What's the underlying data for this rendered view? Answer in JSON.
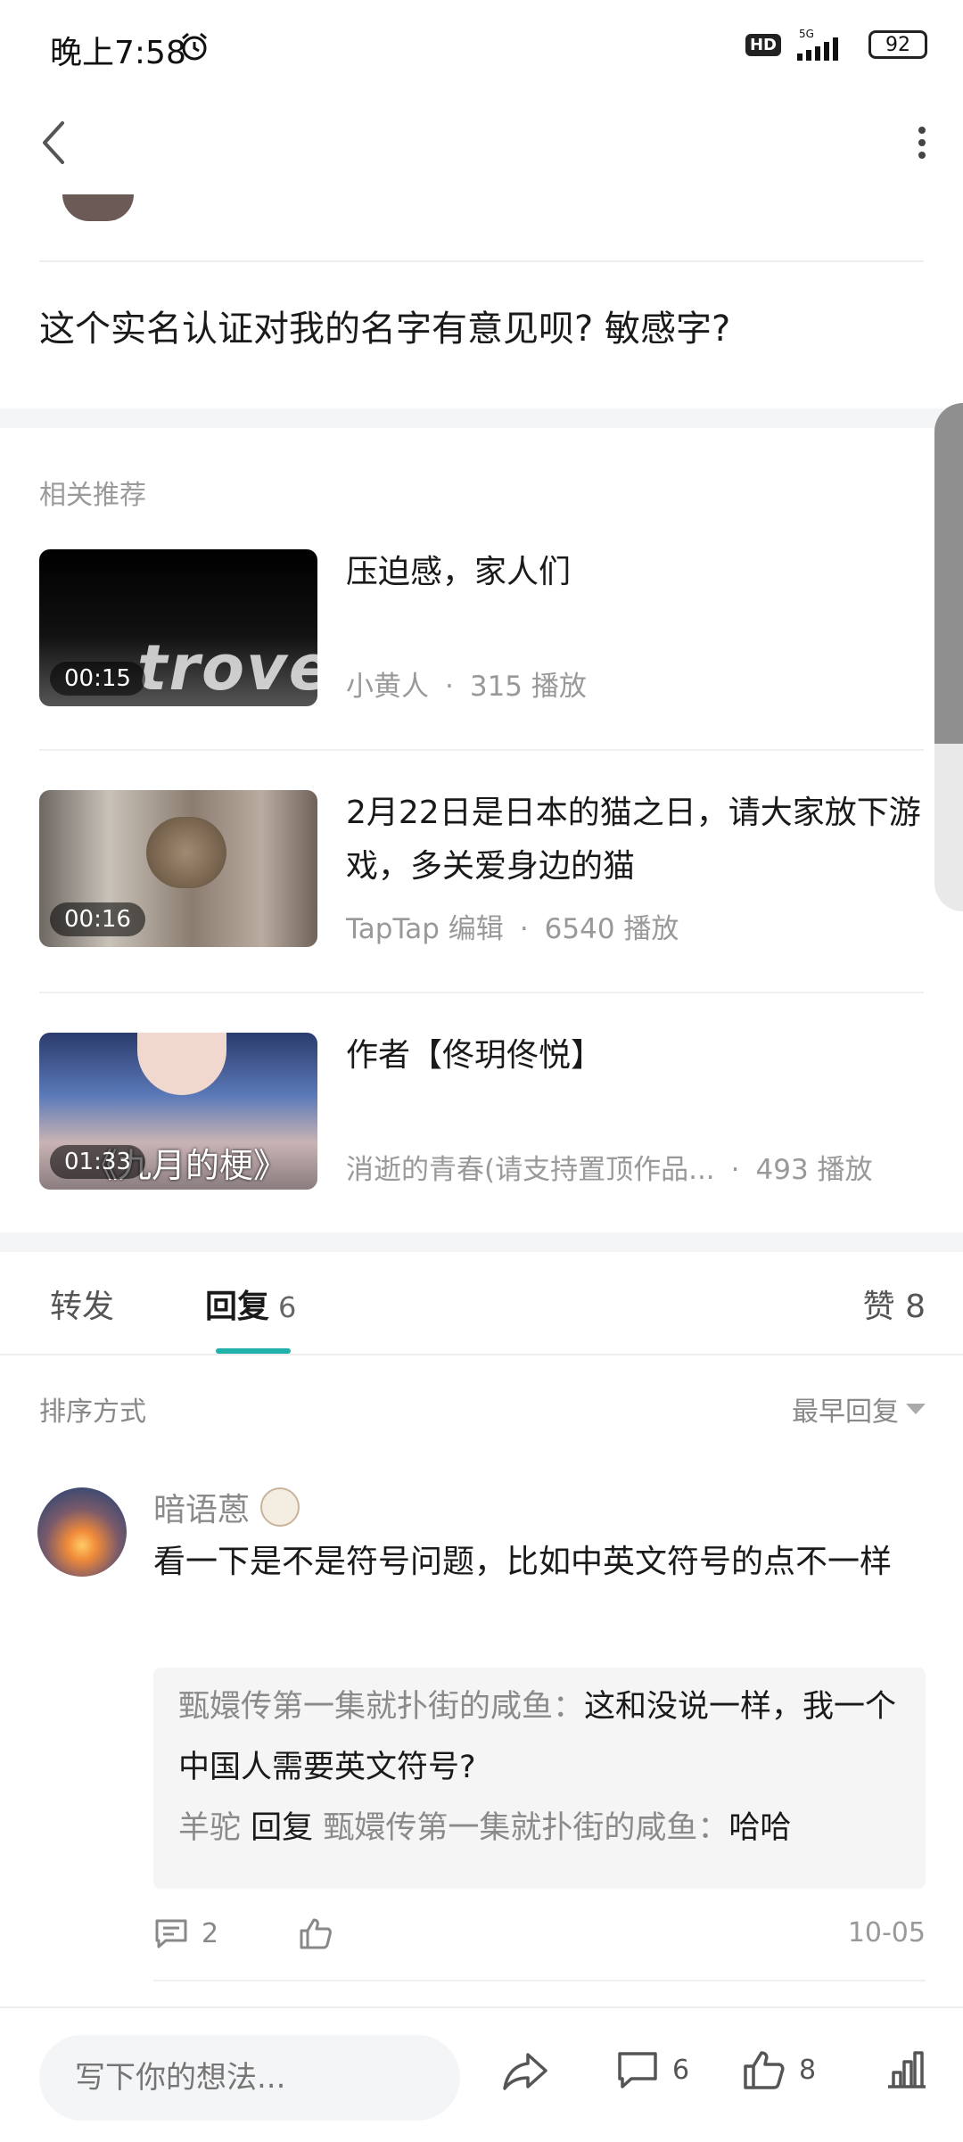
{
  "status_bar": {
    "time": "晚上7:58",
    "hd": "HD",
    "network": "5G",
    "battery": "92"
  },
  "post": {
    "question": "这个实名认证对我的名字有意见呗? 敏感字?"
  },
  "related": {
    "label": "相关推荐",
    "items": [
      {
        "title": "压迫感，家人们",
        "author": "小黄人",
        "plays": "315 播放",
        "duration": "00:15",
        "thumb_text": "trove"
      },
      {
        "title": "2月22日是日本的猫之日，请大家放下游戏，多关爱身边的猫",
        "author": "TapTap 编辑",
        "plays": "6540 播放",
        "duration": "00:16"
      },
      {
        "title": "作者【佟玥佟悦】",
        "author": "消逝的青春(请支持置顶作品...",
        "plays": "493 播放",
        "duration": "01:33",
        "thumb_text": "《九月的梗》"
      }
    ],
    "separator": "·"
  },
  "tabs": {
    "forward": "转发",
    "reply": "回复",
    "reply_count": "6",
    "like": "赞 8"
  },
  "sort": {
    "label": "排序方式",
    "value": "最早回复"
  },
  "comment": {
    "user": "暗语蒽",
    "text": "看一下是不是符号问题，比如中英文符号的点不一样",
    "replies": [
      {
        "name": "甄嬛传第一集就扑街的咸鱼",
        "sep": "：",
        "text": "这和没说一样，我一个中国人需要英文符号?"
      },
      {
        "name": "羊驼",
        "reply_word": "回复",
        "target": "甄嬛传第一集就扑街的咸鱼",
        "sep": "：",
        "text": "哈哈"
      }
    ],
    "reply_count": "2",
    "date": "10-05"
  },
  "bottom_bar": {
    "placeholder": "写下你的想法...",
    "comments": "6",
    "likes": "8"
  }
}
